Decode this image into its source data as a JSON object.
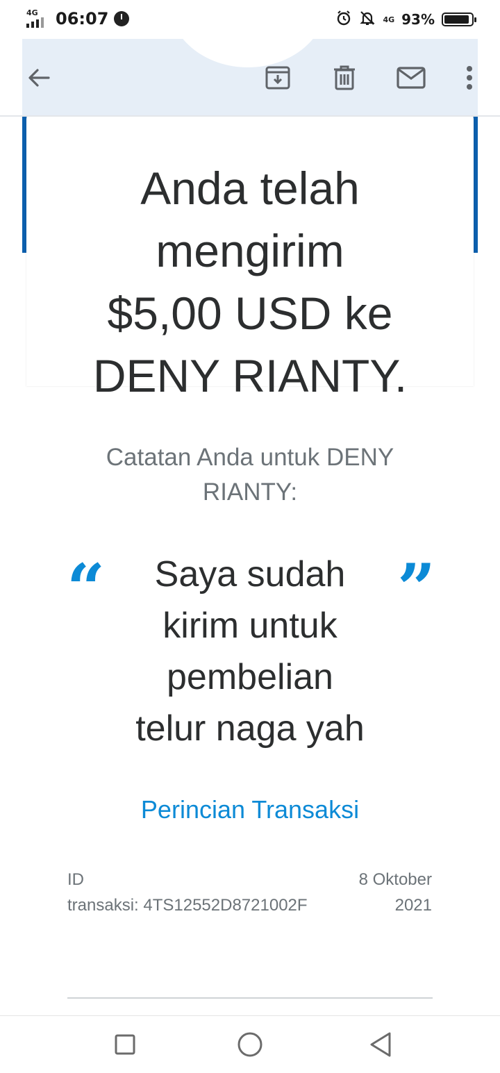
{
  "status_bar": {
    "network_left": "4G",
    "time": "06:07",
    "network_right": "4G",
    "battery_percent": "93%",
    "battery_level": 0.93
  },
  "header": {
    "icons": [
      "back-arrow-icon",
      "archive-icon",
      "delete-icon",
      "mark-unread-icon",
      "more-vert-icon"
    ]
  },
  "email": {
    "headline_lines": [
      "Anda telah",
      "mengirim",
      "$5,00 USD ke",
      "DENY RIANTY."
    ],
    "note_label_lines": [
      "Catatan Anda untuk DENY",
      "RIANTY:"
    ],
    "open_quote": "“",
    "close_quote": "”",
    "note_lines": [
      "Saya sudah",
      "kirim untuk",
      "pembelian",
      "telur naga yah"
    ],
    "details_link": "Perincian Transaksi",
    "transaction_id_lines": [
      "ID",
      "transaksi: 4TS12552D8721002F"
    ],
    "date_lines": [
      "8 Oktober",
      "2021"
    ]
  },
  "colors": {
    "accent_blue": "#0c8ad6",
    "brand_blue": "#0b5fad",
    "header_bg": "#e6eef7",
    "text_dark": "#2c2e2f",
    "text_gray": "#6c7378"
  },
  "nav_bar": {
    "icons": [
      "recents-square-icon",
      "home-circle-icon",
      "back-triangle-icon"
    ]
  }
}
